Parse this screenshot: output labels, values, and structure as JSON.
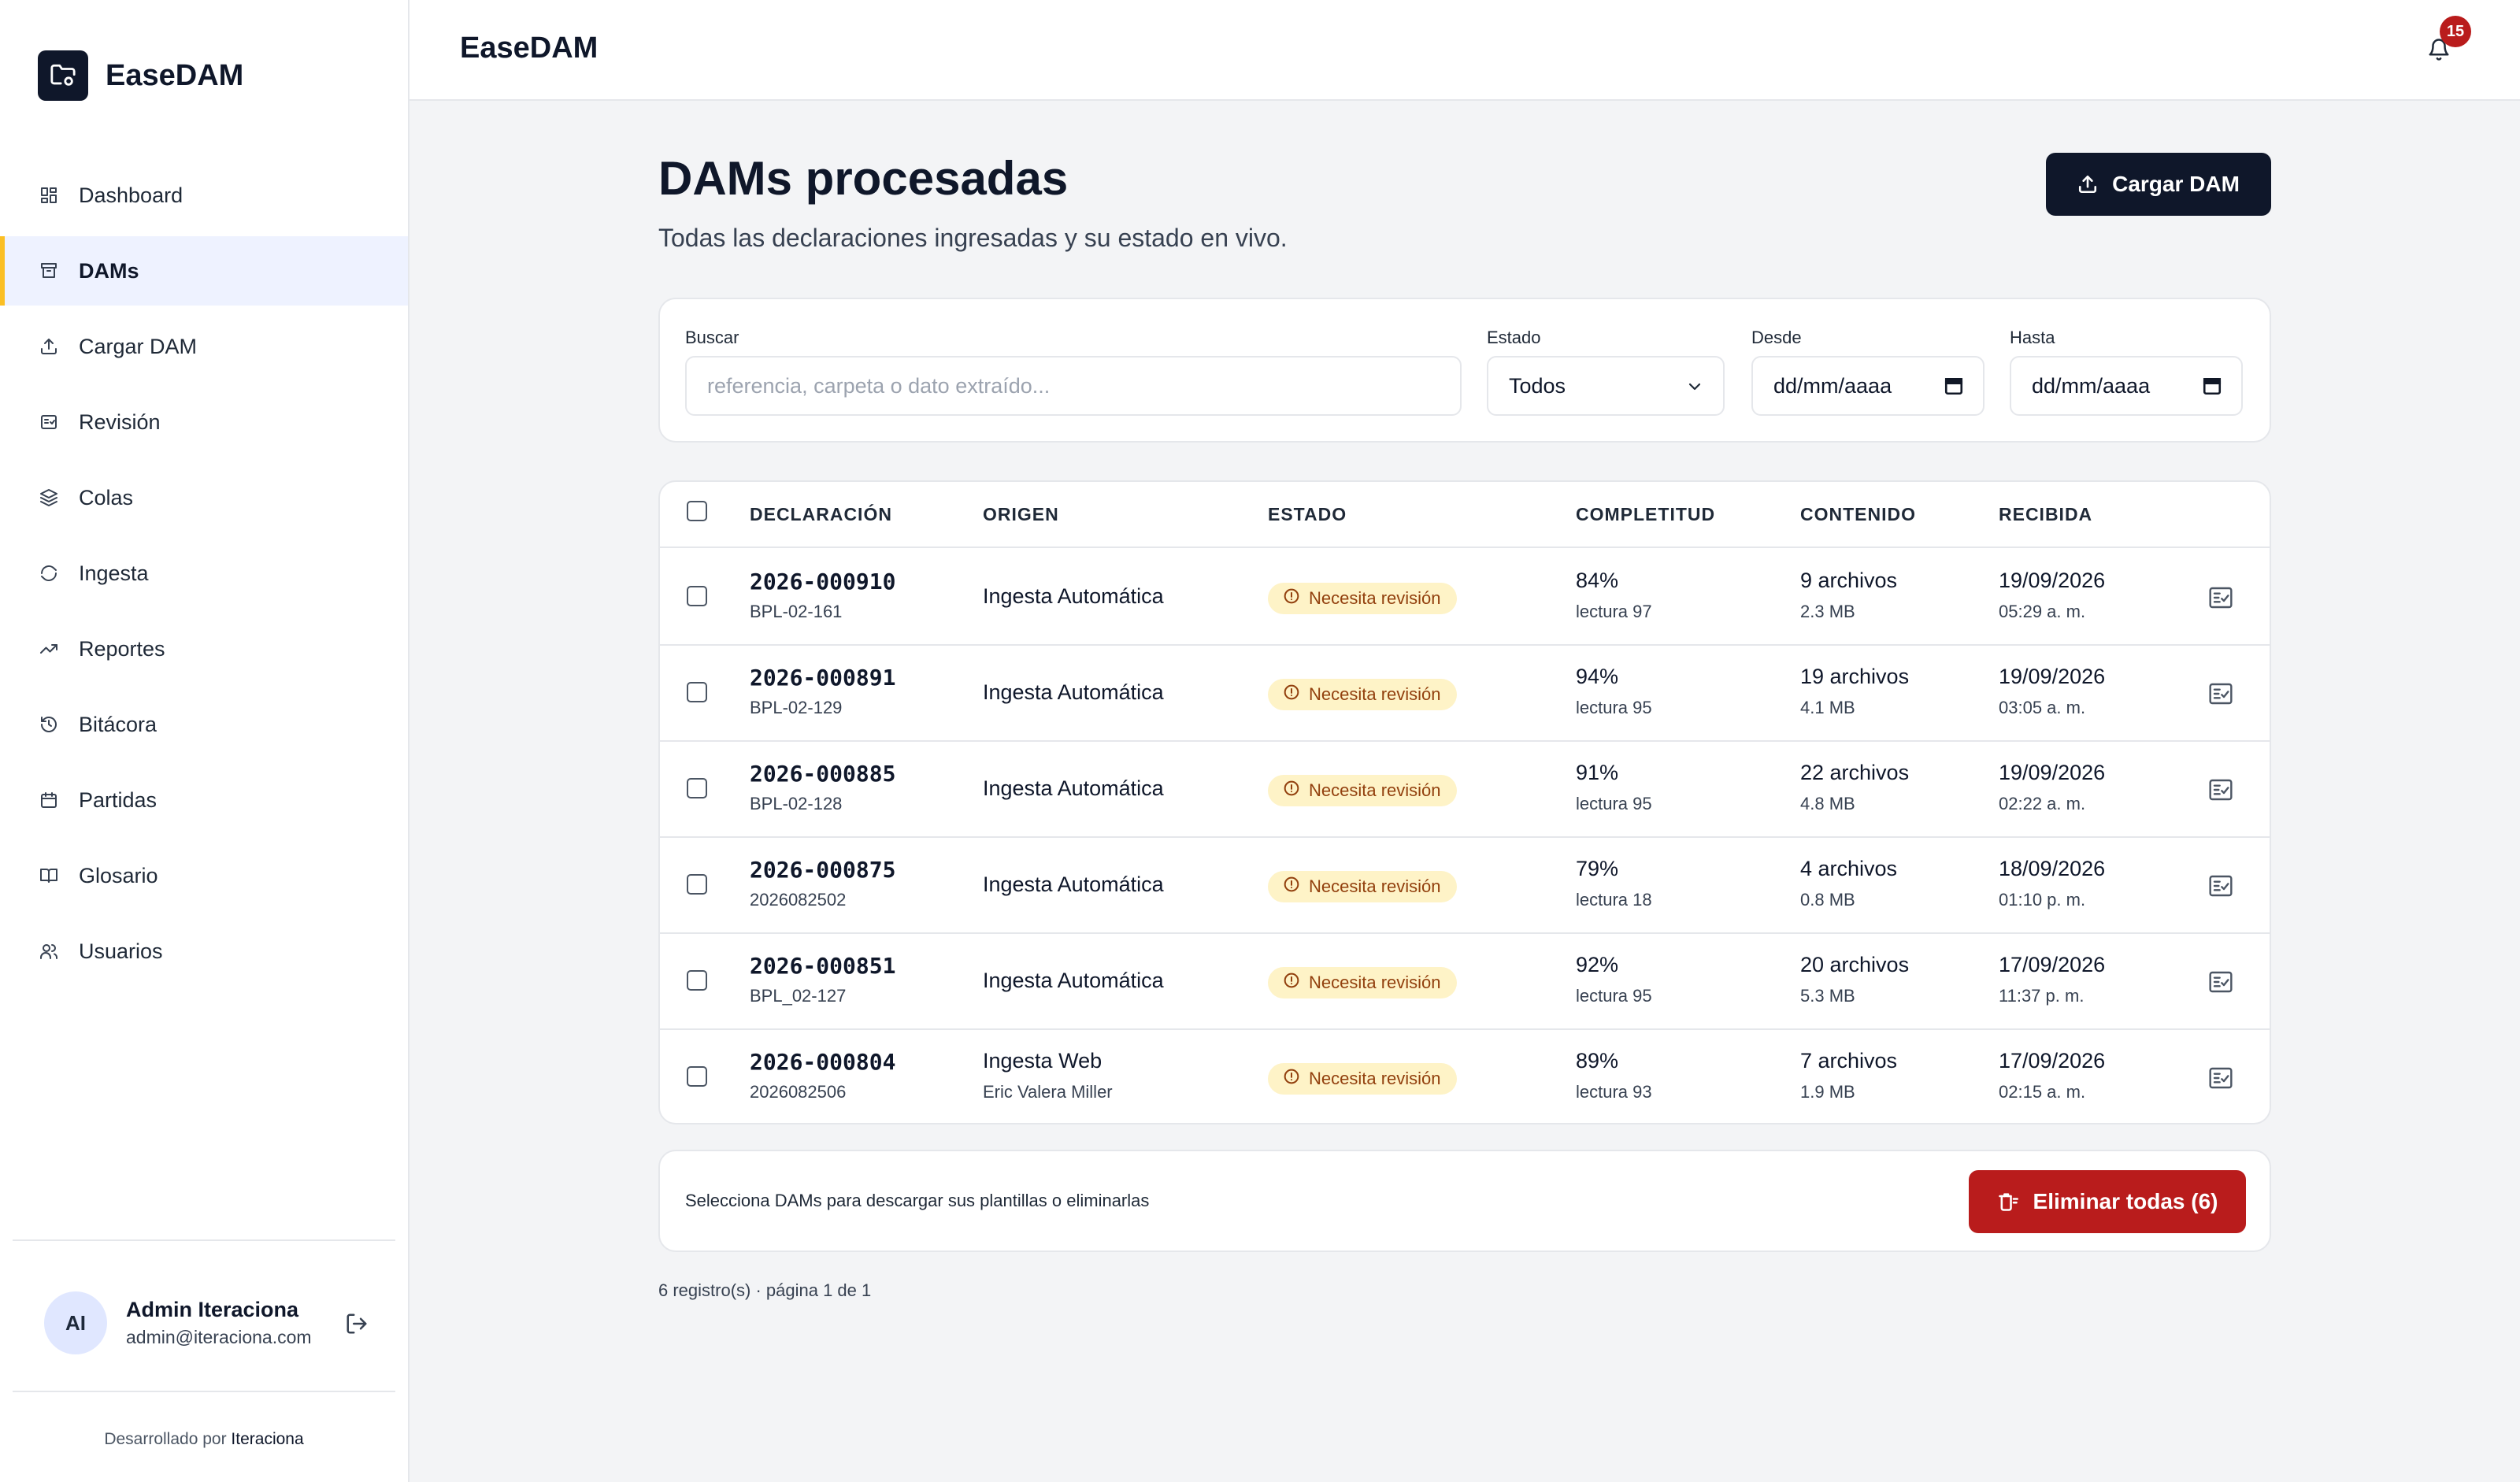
{
  "app": {
    "name": "EaseDAM",
    "notifications": "15"
  },
  "sidebar": {
    "items": [
      {
        "label": "Dashboard",
        "icon": "dashboard-icon",
        "active": false
      },
      {
        "label": "DAMs",
        "icon": "archive-icon",
        "active": true
      },
      {
        "label": "Cargar DAM",
        "icon": "upload-icon",
        "active": false
      },
      {
        "label": "Revisión",
        "icon": "review-icon",
        "active": false
      },
      {
        "label": "Colas",
        "icon": "layers-icon",
        "active": false
      },
      {
        "label": "Ingesta",
        "icon": "refresh-icon",
        "active": false
      },
      {
        "label": "Reportes",
        "icon": "trending-icon",
        "active": false
      },
      {
        "label": "Bitácora",
        "icon": "history-icon",
        "active": false
      },
      {
        "label": "Partidas",
        "icon": "package-icon",
        "active": false
      },
      {
        "label": "Glosario",
        "icon": "book-icon",
        "active": false
      },
      {
        "label": "Usuarios",
        "icon": "users-icon",
        "active": false
      }
    ],
    "user": {
      "initials": "AI",
      "name": "Admin Iteraciona",
      "email": "admin@iteraciona.com"
    },
    "credit_prefix": "Desarrollado por ",
    "credit_brand": "Iteraciona"
  },
  "page": {
    "title": "DAMs procesadas",
    "subtitle": "Todas las declaraciones ingresadas y su estado en vivo.",
    "upload_label": "Cargar DAM"
  },
  "filters": {
    "search_label": "Buscar",
    "search_placeholder": "referencia, carpeta o dato extraído...",
    "status_label": "Estado",
    "status_value": "Todos",
    "from_label": "Desde",
    "from_value": "dd/mm/aaaa",
    "to_label": "Hasta",
    "to_value": "dd/mm/aaaa"
  },
  "table": {
    "headers": [
      "DECLARACIÓN",
      "ORIGEN",
      "ESTADO",
      "COMPLETITUD",
      "CONTENIDO",
      "RECIBIDA"
    ],
    "rows": [
      {
        "id": "2026-000910",
        "ref": "BPL-02-161",
        "origin": "Ingesta Automática",
        "origin_sub": "",
        "status": "Necesita revisión",
        "completeness": "84%",
        "reading": "lectura 97",
        "files": "9 archivos",
        "size": "2.3 MB",
        "date": "19/09/2026",
        "time": "05:29 a. m."
      },
      {
        "id": "2026-000891",
        "ref": "BPL-02-129",
        "origin": "Ingesta Automática",
        "origin_sub": "",
        "status": "Necesita revisión",
        "completeness": "94%",
        "reading": "lectura 95",
        "files": "19 archivos",
        "size": "4.1 MB",
        "date": "19/09/2026",
        "time": "03:05 a. m."
      },
      {
        "id": "2026-000885",
        "ref": "BPL-02-128",
        "origin": "Ingesta Automática",
        "origin_sub": "",
        "status": "Necesita revisión",
        "completeness": "91%",
        "reading": "lectura 95",
        "files": "22 archivos",
        "size": "4.8 MB",
        "date": "19/09/2026",
        "time": "02:22 a. m."
      },
      {
        "id": "2026-000875",
        "ref": "2026082502",
        "origin": "Ingesta Automática",
        "origin_sub": "",
        "status": "Necesita revisión",
        "completeness": "79%",
        "reading": "lectura 18",
        "files": "4 archivos",
        "size": "0.8 MB",
        "date": "18/09/2026",
        "time": "01:10 p. m."
      },
      {
        "id": "2026-000851",
        "ref": "BPL_02-127",
        "origin": "Ingesta Automática",
        "origin_sub": "",
        "status": "Necesita revisión",
        "completeness": "92%",
        "reading": "lectura 95",
        "files": "20 archivos",
        "size": "5.3 MB",
        "date": "17/09/2026",
        "time": "11:37 p. m."
      },
      {
        "id": "2026-000804",
        "ref": "2026082506",
        "origin": "Ingesta Web",
        "origin_sub": "Eric Valera Miller",
        "status": "Necesita revisión",
        "completeness": "89%",
        "reading": "lectura 93",
        "files": "7 archivos",
        "size": "1.9 MB",
        "date": "17/09/2026",
        "time": "02:15 a. m."
      }
    ]
  },
  "bulk": {
    "hint": "Selecciona DAMs para descargar sus plantillas o eliminarlas",
    "delete_label": "Eliminar todas (6)"
  },
  "pager": "6 registro(s) · página 1 de 1",
  "colors": {
    "primary": "#0f172a",
    "accent": "#fbbf24",
    "danger": "#b91c1c",
    "warning_bg": "#fef3c7",
    "warning_fg": "#92400e"
  }
}
